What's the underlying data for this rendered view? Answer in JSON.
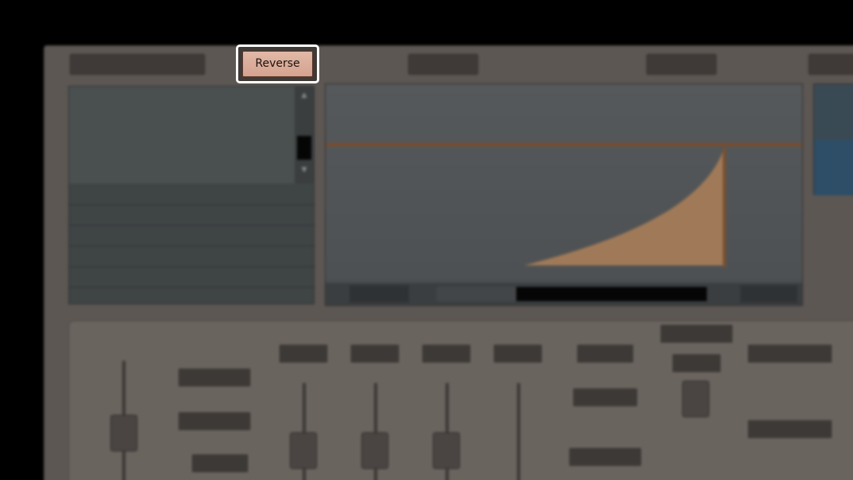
{
  "toolbar": {
    "reverse_label": "Reverse"
  },
  "colors": {
    "reverse_button": "#d9ac99",
    "envelope_fill": "#a07a58",
    "envelope_line": "#7a4b2c"
  }
}
